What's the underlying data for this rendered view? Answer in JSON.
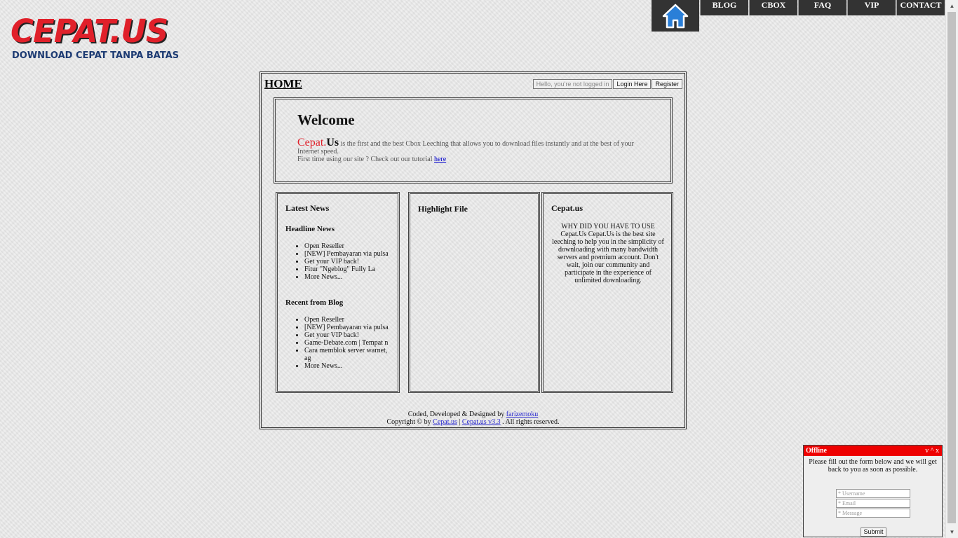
{
  "logo": {
    "main": "CEPAT.US",
    "sub": "DOWNLOAD CEPAT TANPA BATAS"
  },
  "nav": {
    "items": [
      "BLOG",
      "CBOX",
      "FAQ",
      "VIP",
      "CONTACT"
    ]
  },
  "header": {
    "title": "HOME",
    "status": "Hello, you're not logged in",
    "login": "Login Here",
    "register": "Register"
  },
  "welcome": {
    "title": "Welcome",
    "brand1": "Cepat.",
    "brand2": "Us",
    "body": " is the first and the best Cbox Leeching that allows you to download files instantly and at the best of your Internet speed.",
    "tutorial_text": "First time using our site ? Check out our tutorial ",
    "tutorial_link": "here"
  },
  "latest_news": {
    "title": "Latest News",
    "headline_title": "Headline News",
    "headline_items": [
      "Open Reseller",
      "[NEW] Pembayaran via pulsa",
      "Get your VIP back!",
      "Fitur \"Ngeblog\" Fully La",
      "More News..."
    ],
    "blog_title": "Recent from Blog",
    "blog_items": [
      "Open Reseller",
      "[NEW] Pembayaran via pulsa",
      "Get your VIP back!",
      "Game-Debate.com | Tempat n",
      "Cara memblok server warnet, ag",
      "More News..."
    ]
  },
  "highlight": {
    "title": "Highlight File"
  },
  "cepat": {
    "title": "Cepat.us",
    "description": "WHY DID YOU HAVE TO USE Cepat.Us Cepat.Us is the best site leeching to help you in the simplicity of downloading with many bandwidth servers and premium account. Don't wait, join our community and participate in the experience of unlimited downloading."
  },
  "footer": {
    "line1_prefix": "Coded, Developed & Designed by ",
    "author": "farizemoku",
    "line2_prefix": "Copyright © by ",
    "site_link": "Cepat.us",
    "separator": " | ",
    "version_link": "Cepat.us v3.3",
    "line2_suffix": " . All rights reserved."
  },
  "chat": {
    "status": "Offline",
    "controls": "v ^ x",
    "message": "Please fill out the form below and we will get back to you as soon as possible.",
    "username_placeholder": "* Username",
    "email_placeholder": "* Email",
    "message_placeholder": "* Message",
    "submit": "Submit"
  },
  "colors": {
    "brand_red": "#e0202a",
    "nav_bg": "#333333",
    "link_blue": "#2a2ad0"
  }
}
